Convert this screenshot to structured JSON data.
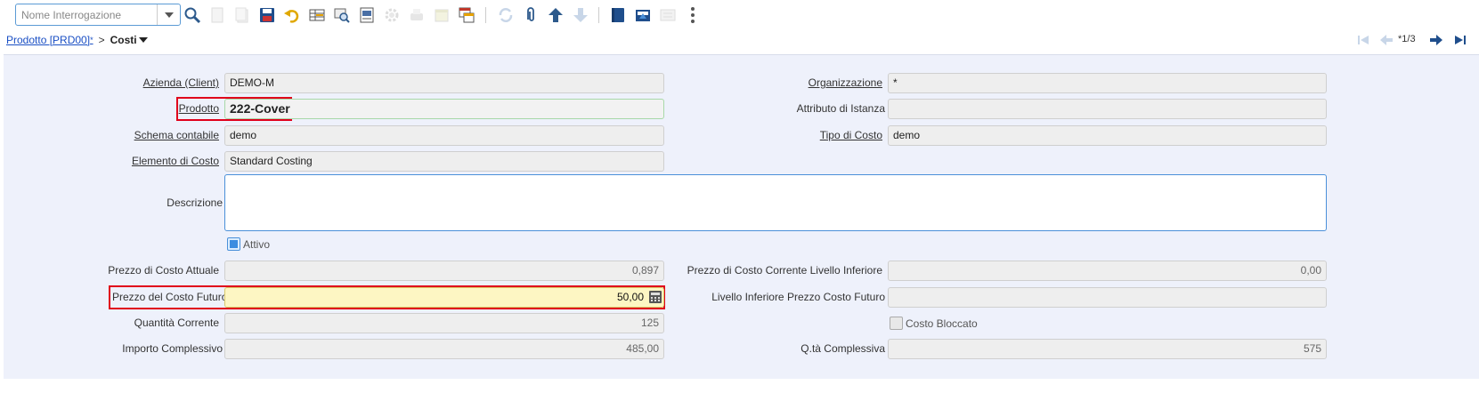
{
  "toolbar": {
    "query_placeholder": "Nome Interrogazione",
    "icons": [
      "search-icon",
      "new-record-icon",
      "copy-icon",
      "save-icon",
      "undo-icon",
      "grid-toggle-icon",
      "zoom-icon",
      "report-icon",
      "process-icon",
      "print-icon",
      "archive-icon",
      "window-icon",
      "refresh-icon",
      "attachment-icon",
      "up-arrow-icon",
      "down-arrow-icon",
      "book-icon",
      "export-icon",
      "form-icon",
      "more-icon"
    ]
  },
  "breadcrumb": {
    "parent": "Prodotto [PRD00]",
    "parent_marker": "*",
    "separator": ">",
    "current": "Costi"
  },
  "navigation": {
    "record_count": "*1/3"
  },
  "form": {
    "client_label": "Azienda (Client)",
    "client_value": "DEMO-M",
    "org_label": "Organizzazione",
    "org_value": "*",
    "product_label": "Prodotto",
    "product_value": "222-Cover",
    "instance_attr_label": "Attributo di Istanza",
    "instance_attr_value": "",
    "schema_label": "Schema contabile",
    "schema_value": "demo",
    "cost_type_label": "Tipo di Costo",
    "cost_type_value": "demo",
    "cost_element_label": "Elemento di Costo",
    "cost_element_value": "Standard Costing",
    "description_label": "Descrizione",
    "description_value": "",
    "active_label": "Attivo",
    "current_cost_label": "Prezzo di Costo Attuale",
    "current_cost_value": "0,897",
    "lower_level_cost_label": "Prezzo di Costo Corrente Livello Inferiore",
    "lower_level_cost_value": "0,00",
    "future_cost_label": "Prezzo del Costo Futuro",
    "future_cost_value": "50,00",
    "future_lower_label": "Livello Inferiore Prezzo Costo Futuro",
    "future_lower_value": "",
    "current_qty_label": "Quantità Corrente",
    "current_qty_value": "125",
    "cost_frozen_label": "Costo Bloccato",
    "total_amount_label": "Importo Complessivo",
    "total_amount_value": "485,00",
    "total_qty_label": "Q.tà Complessiva",
    "total_qty_value": "575"
  },
  "colors": {
    "highlight": "#e0001b",
    "link": "#1a4fc4",
    "panel": "#eef1fb",
    "active_field": "#fdf6c3"
  }
}
